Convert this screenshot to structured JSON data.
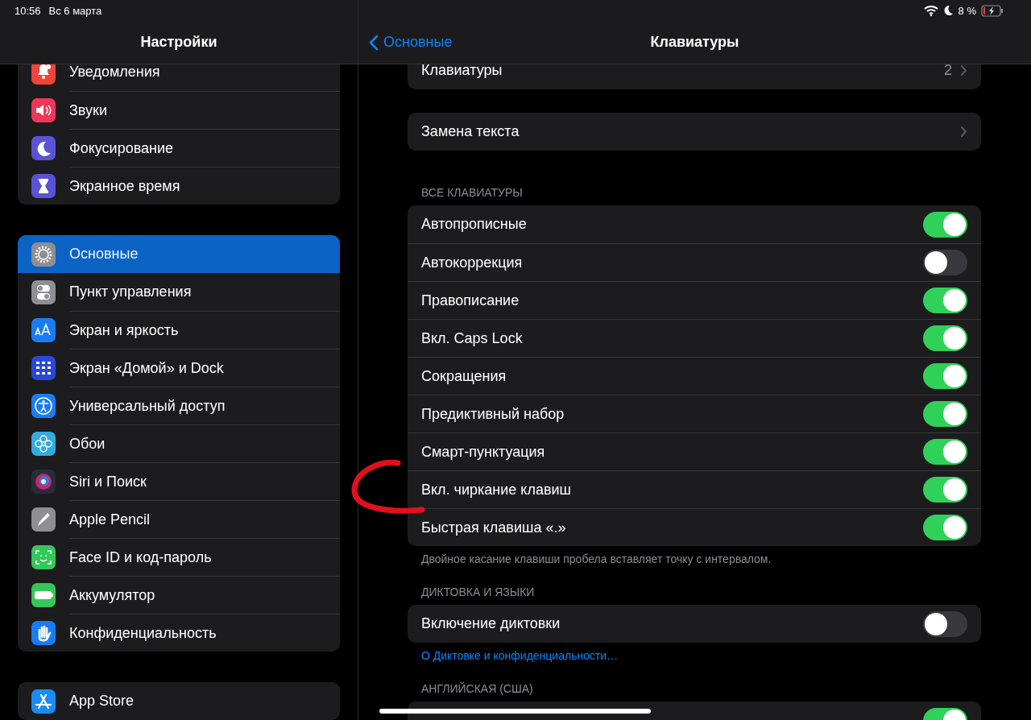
{
  "status_bar": {
    "time": "10:56",
    "date": "Вс 6 марта",
    "battery_percent": "8 %",
    "charging": true
  },
  "sidebar": {
    "title": "Настройки",
    "groups": [
      {
        "items": [
          {
            "label": "Уведомления",
            "color": "#f0443a",
            "selected": false
          },
          {
            "label": "Звуки",
            "color": "#f2355a",
            "selected": false
          },
          {
            "label": "Фокусирование",
            "color": "#5b52d6",
            "selected": false
          },
          {
            "label": "Экранное время",
            "color": "#5b52d6",
            "selected": false
          }
        ]
      },
      {
        "items": [
          {
            "label": "Основные",
            "color": "#8e8e93",
            "selected": true
          },
          {
            "label": "Пункт управления",
            "color": "#8e8e93",
            "selected": false
          },
          {
            "label": "Экран и яркость",
            "color": "#1a7cf5",
            "selected": false
          },
          {
            "label": "Экран «Домой» и Dock",
            "color": "#2a48d8",
            "selected": false
          },
          {
            "label": "Универсальный доступ",
            "color": "#1a7cf5",
            "selected": false
          },
          {
            "label": "Обои",
            "color": "#35aadc",
            "selected": false
          },
          {
            "label": "Siri и Поиск",
            "color": "#2a2a3a",
            "selected": false
          },
          {
            "label": "Apple Pencil",
            "color": "#8e8e93",
            "selected": false
          },
          {
            "label": "Face ID и код-пароль",
            "color": "#34c759",
            "selected": false
          },
          {
            "label": "Аккумулятор",
            "color": "#34c759",
            "selected": false
          },
          {
            "label": "Конфиденциальность",
            "color": "#1a7cf5",
            "selected": false
          }
        ]
      },
      {
        "items": [
          {
            "label": "App Store",
            "color": "#1a8cf5",
            "selected": false
          }
        ]
      }
    ]
  },
  "detail": {
    "back": "Основные",
    "title": "Клавиатуры",
    "sections": [
      {
        "rows": [
          {
            "kind": "link",
            "label": "Клавиатуры",
            "value": "2"
          }
        ]
      },
      {
        "rows": [
          {
            "kind": "link",
            "label": "Замена текста"
          }
        ]
      },
      {
        "header": "ВСЕ КЛАВИАТУРЫ",
        "rows": [
          {
            "kind": "toggle",
            "label": "Автопрописные",
            "on": true
          },
          {
            "kind": "toggle",
            "label": "Автокоррекция",
            "on": false
          },
          {
            "kind": "toggle",
            "label": "Правописание",
            "on": true
          },
          {
            "kind": "toggle",
            "label": "Вкл. Caps Lock",
            "on": true
          },
          {
            "kind": "toggle",
            "label": "Сокращения",
            "on": true
          },
          {
            "kind": "toggle",
            "label": "Предиктивный набор",
            "on": true
          },
          {
            "kind": "toggle",
            "label": "Смарт-пунктуация",
            "on": true
          },
          {
            "kind": "toggle",
            "label": "Вкл. чиркание клавиш",
            "on": true
          },
          {
            "kind": "toggle",
            "label": "Быстрая клавиша «.»",
            "on": true
          }
        ],
        "footer": {
          "kind": "note",
          "text": "Двойное касание клавиши пробела вставляет точку с интервалом."
        }
      },
      {
        "header": "ДИКТОВКА И ЯЗЫКИ",
        "rows": [
          {
            "kind": "toggle",
            "label": "Включение диктовки",
            "on": false
          }
        ],
        "footer": {
          "kind": "link",
          "text": "О Диктовке и конфиденциальности…"
        }
      },
      {
        "header": "АНГЛИЙСКАЯ (США)",
        "rows": [
          {
            "kind": "toggle",
            "on": true
          }
        ]
      }
    ]
  }
}
